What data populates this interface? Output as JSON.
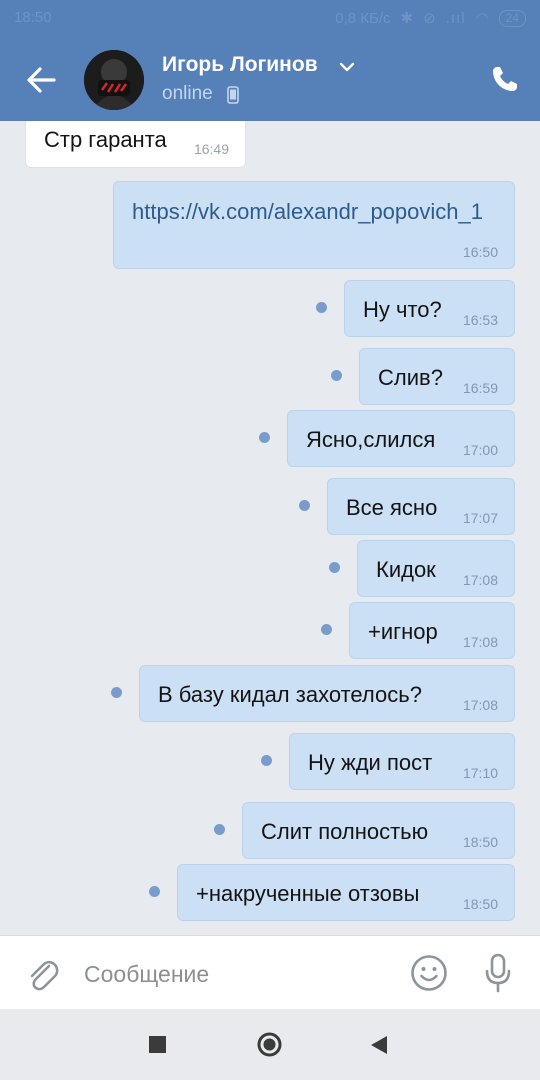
{
  "status": {
    "time": "18:50",
    "net_speed": "0,8 КБ/с",
    "battery": "24"
  },
  "header": {
    "name": "Игорь Логинов",
    "status": "online"
  },
  "messages": [
    {
      "dir": "in",
      "text": "Стр гаранта",
      "time": "16:49"
    },
    {
      "dir": "out",
      "text": "https://vk.com/alexandr_popovich_1",
      "time": "16:50",
      "link": true
    },
    {
      "dir": "out",
      "text": "Ну что?",
      "time": "16:53",
      "unread": true
    },
    {
      "dir": "out",
      "text": "Слив?",
      "time": "16:59",
      "unread": true
    },
    {
      "dir": "out",
      "text": "Ясно,слился",
      "time": "17:00",
      "unread": true
    },
    {
      "dir": "out",
      "text": "Все ясно",
      "time": "17:07",
      "unread": true
    },
    {
      "dir": "out",
      "text": "Кидок",
      "time": "17:08",
      "unread": true
    },
    {
      "dir": "out",
      "text": "+игнор",
      "time": "17:08",
      "unread": true
    },
    {
      "dir": "out",
      "text": "В базу кидал захотелось?",
      "time": "17:08",
      "unread": true
    },
    {
      "dir": "out",
      "text": "Ну жди пост",
      "time": "17:10",
      "unread": true
    },
    {
      "dir": "out",
      "text": "Слит полностью",
      "time": "18:50",
      "unread": true
    },
    {
      "dir": "out",
      "text": "+накрученные отзовы",
      "time": "18:50",
      "unread": true
    }
  ],
  "composer": {
    "placeholder": "Сообщение"
  },
  "colors": {
    "header": "#5580b8",
    "background": "#e7ebf0",
    "outgoing_bubble": "#cce0f5",
    "unread_dot": "#7a9ccd"
  },
  "icons": [
    "back-arrow-icon",
    "chevron-down-icon",
    "mobile-phone-icon",
    "call-icon",
    "attach-icon",
    "emoji-icon",
    "mic-icon"
  ]
}
